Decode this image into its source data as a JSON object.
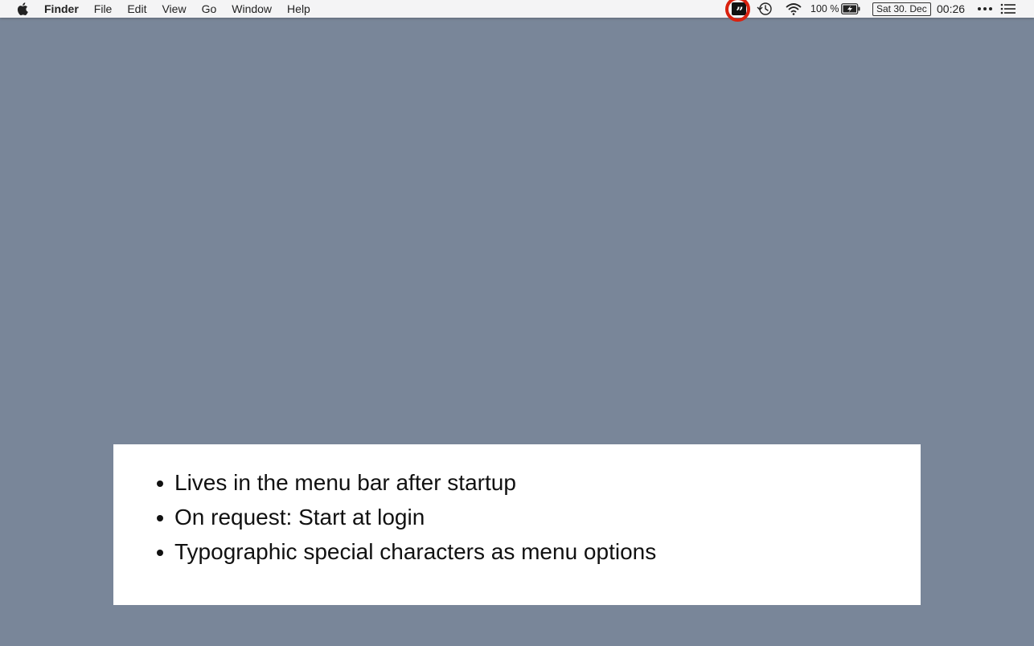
{
  "menubar": {
    "app_name": "Finder",
    "menus": [
      "File",
      "Edit",
      "View",
      "Go",
      "Window",
      "Help"
    ],
    "status": {
      "battery_percent": "100 %",
      "date": "Sat 30. Dec",
      "time": "00:26",
      "highlight_color": "#d9210f",
      "quote_icon_glyph": "”"
    }
  },
  "content": {
    "bullets": [
      "Lives in the menu bar after startup",
      "On request: Start at login",
      "Typographic special characters as menu options"
    ]
  },
  "colors": {
    "desktop_background": "#798699",
    "menubar_background": "#f4f4f5",
    "panel_background": "#ffffff"
  }
}
